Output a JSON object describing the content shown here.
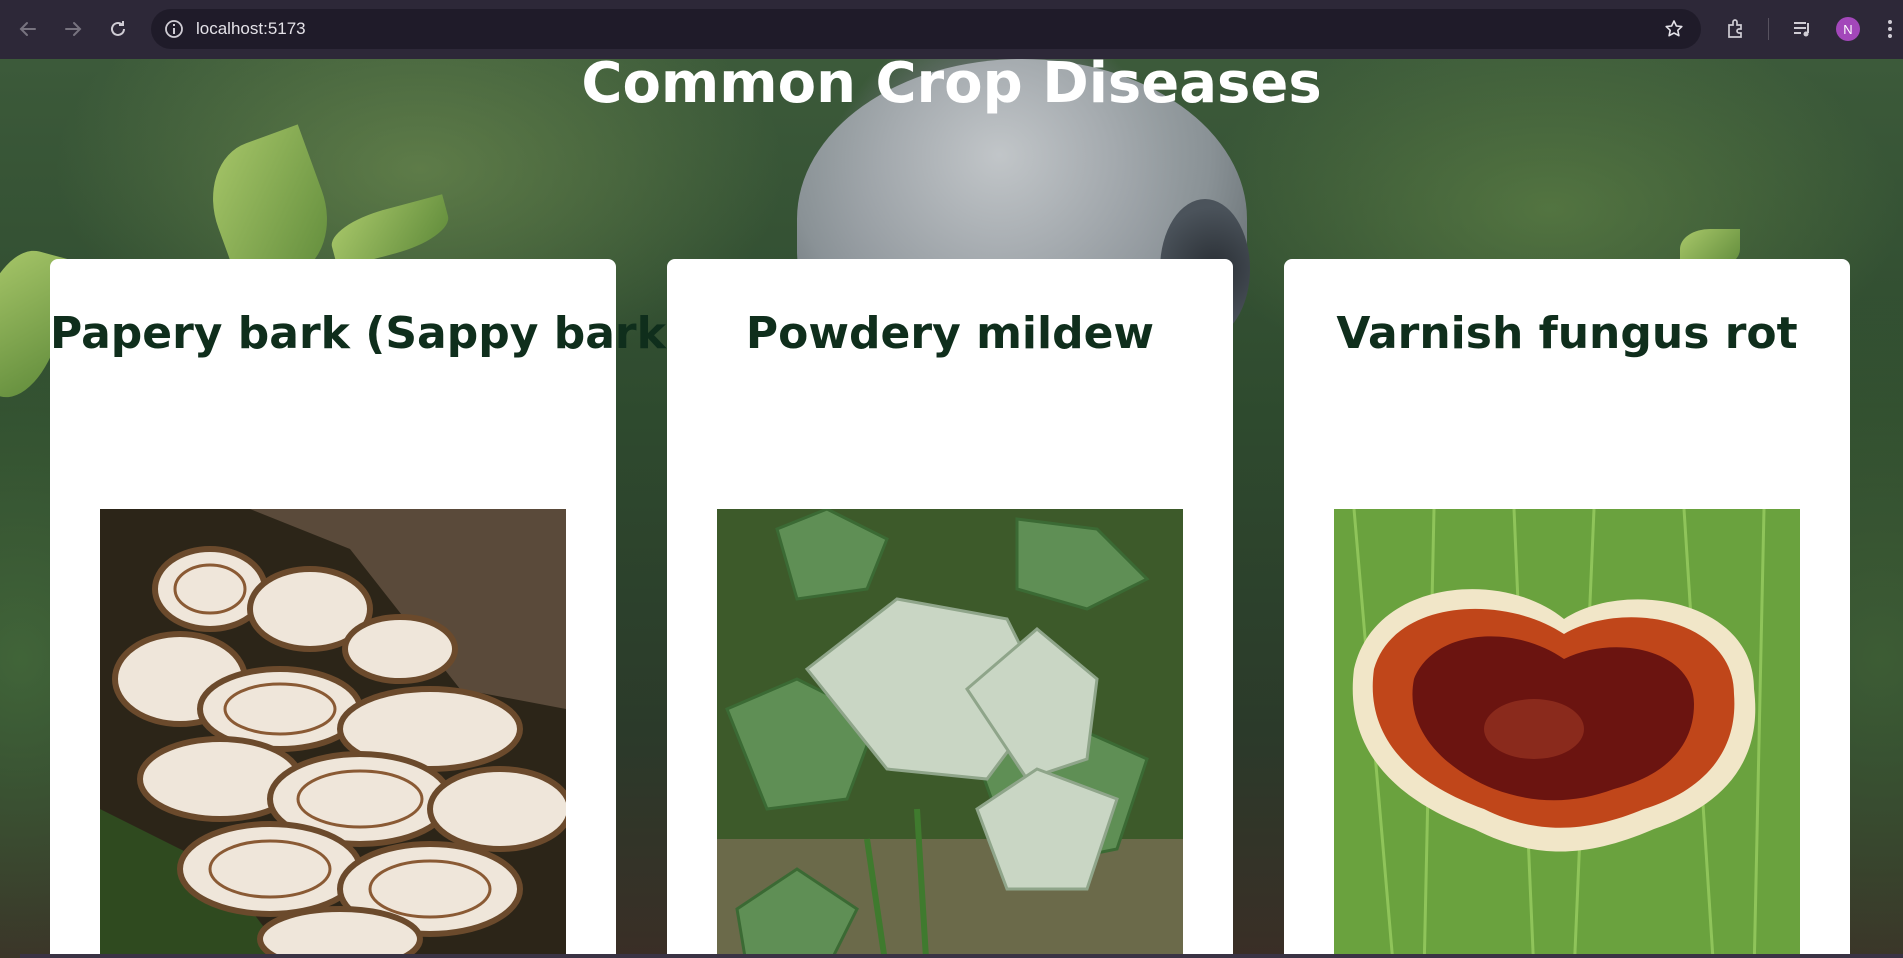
{
  "browser": {
    "url": "localhost:5173",
    "avatar_initial": "N",
    "icons": [
      "back-icon",
      "forward-icon",
      "reload-icon",
      "info-icon",
      "star-icon",
      "extensions-icon",
      "media-icon",
      "menu-icon"
    ]
  },
  "page": {
    "title": "Common Crop Diseases",
    "cards": [
      {
        "title": "Papery bark (Sappy bark)"
      },
      {
        "title": "Powdery mildew"
      },
      {
        "title": "Varnish fungus rot"
      }
    ]
  },
  "colors": {
    "card_title": "#0f2e1c",
    "page_title": "#ffffff",
    "avatar": "#a347ba"
  }
}
